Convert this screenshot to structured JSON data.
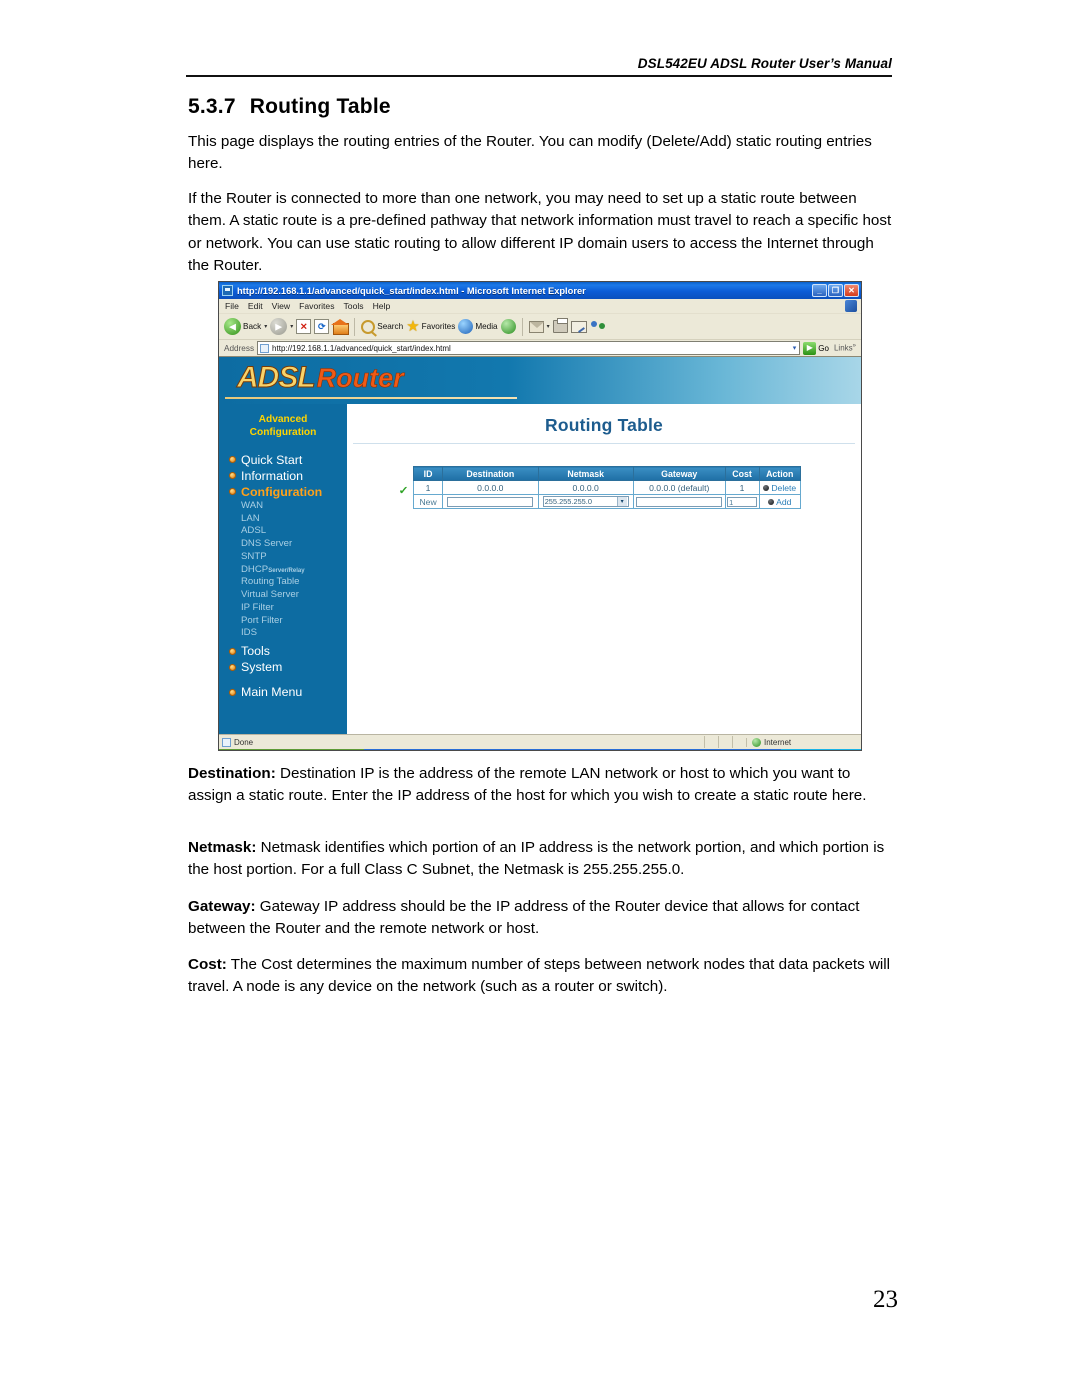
{
  "document": {
    "running_header": "DSL542EU ADSL Router User’s Manual",
    "section_number": "5.3.7",
    "section_title": "Routing Table",
    "paragraphs": [
      "This page displays the routing entries of the Router. You can modify (Delete/Add) static routing entries here.",
      "If the Router is connected to more than one network, you may need to set up a static route between them. A static route is a pre-defined pathway that network information must travel to reach a specific host or network. You can use static routing to allow different IP domain users to access the Internet through the Router."
    ],
    "definitions": [
      {
        "term": "Destination:",
        "text": " Destination IP is the address of the remote LAN network or host to which you want to assign a static route. Enter the IP address of the host for which you wish to create a static route here."
      },
      {
        "term": "Netmask:",
        "text": " Netmask identifies which portion of an IP address is the network portion, and which portion is the host portion. For a full Class C Subnet, the Netmask is 255.255.255.0."
      },
      {
        "term": "Gateway:",
        "text": " Gateway IP address should be the IP address of the Router device that allows for contact between the Router and the remote network or host."
      },
      {
        "term": "Cost:",
        "text": " The Cost determines the maximum number of steps between network nodes that data packets will travel. A node is any device on the network (such as a router or switch)."
      }
    ],
    "page_number": "23"
  },
  "browser": {
    "title": "http://192.168.1.1/advanced/quick_start/index.html - Microsoft Internet Explorer",
    "window_buttons": {
      "minimize": "_",
      "maximize": "❐",
      "close": "✕"
    },
    "menu": [
      "File",
      "Edit",
      "View",
      "Favorites",
      "Tools",
      "Help"
    ],
    "toolbar": {
      "back": "Back",
      "forward": "",
      "stop": "✕",
      "refresh": "⟳",
      "home": "",
      "search": "Search",
      "favorites": "Favorites",
      "media": "Media",
      "history": "",
      "mail": "",
      "print": "",
      "edit": "",
      "messenger": "",
      "caret": "▾"
    },
    "address": {
      "label": "Address",
      "value": "http://192.168.1.1/advanced/quick_start/index.html",
      "go_label": "Go",
      "links_label": "Links",
      "links_sup": "»",
      "dropdown_caret": "▾"
    },
    "status": {
      "text": "Done",
      "zone": "Internet"
    }
  },
  "router_ui": {
    "logo": {
      "adsl": "ADSL",
      "router": "Router"
    },
    "sidebar": {
      "heading_line1": "Advanced",
      "heading_line2": "Configuration",
      "main_items": [
        {
          "label": "Quick Start",
          "active": false
        },
        {
          "label": "Information",
          "active": false
        },
        {
          "label": "Configuration",
          "active": true
        }
      ],
      "sub_items": [
        {
          "label": "WAN",
          "sup": ""
        },
        {
          "label": "LAN",
          "sup": ""
        },
        {
          "label": "ADSL",
          "sup": ""
        },
        {
          "label": "DNS Server",
          "sup": ""
        },
        {
          "label": "SNTP",
          "sup": ""
        },
        {
          "label": "DHCP",
          "sup": "Server/Relay"
        },
        {
          "label": "Routing Table",
          "sup": ""
        },
        {
          "label": "Virtual Server",
          "sup": ""
        },
        {
          "label": "IP Filter",
          "sup": ""
        },
        {
          "label": "Port Filter",
          "sup": ""
        },
        {
          "label": "IDS",
          "sup": ""
        }
      ],
      "bottom_items": [
        {
          "label": "Tools"
        },
        {
          "label": "System"
        }
      ],
      "main_menu": "Main Menu"
    },
    "page_title": "Routing Table",
    "table": {
      "columns": [
        "ID",
        "Destination",
        "Netmask",
        "Gateway",
        "Cost",
        "Action"
      ],
      "rows": [
        {
          "id": "1",
          "destination": "0.0.0.0",
          "netmask": "0.0.0.0",
          "gateway": "0.0.0.0 (default)",
          "cost": "1",
          "action": "Delete",
          "selected_check": "✓"
        }
      ],
      "new_row": {
        "id": "New",
        "destination_value": "",
        "netmask_value": "255.255.255.0",
        "netmask_caret": "▾",
        "gateway_value": "",
        "cost_value": "1",
        "action": "Add"
      }
    }
  },
  "colors": {
    "sidebar_blue": "#0d6ca2",
    "accent_orange": "#ffa11a",
    "heading_yellow": "#ffd400",
    "table_header_blue": "#2b7fb8",
    "link_blue": "#2b7fb8",
    "title_blue": "#1d5c8e"
  }
}
